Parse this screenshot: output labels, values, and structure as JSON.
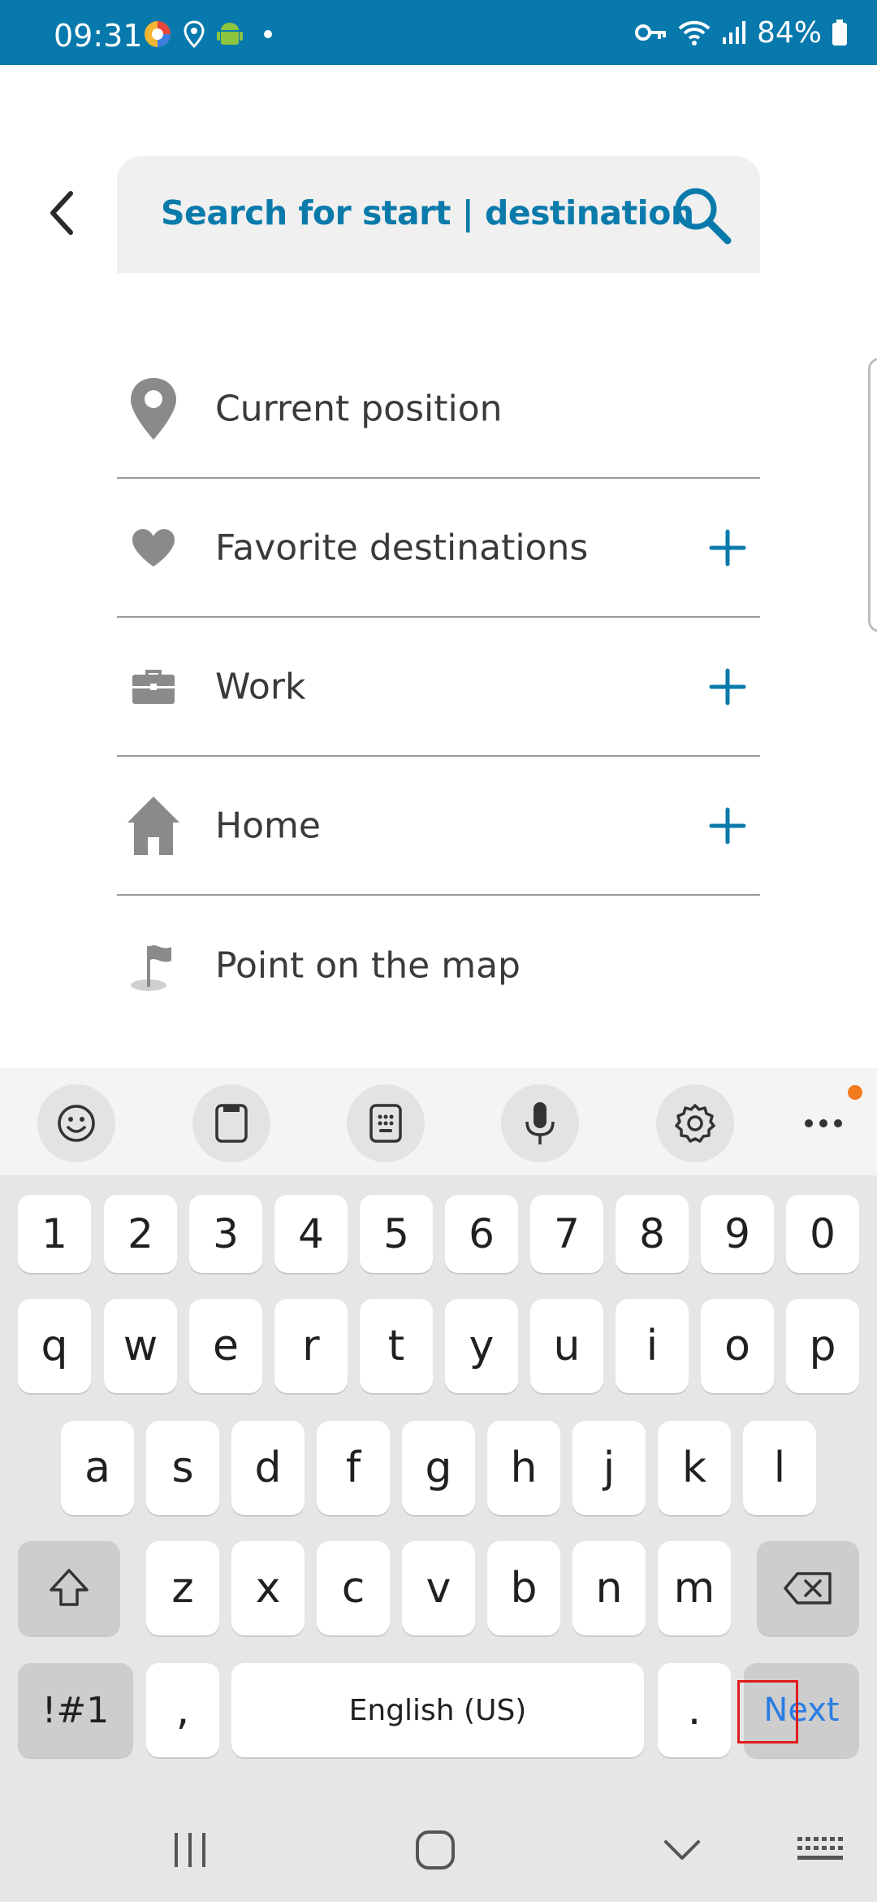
{
  "status_bar": {
    "time": "09:31",
    "battery": "84%",
    "left_icons": [
      "app-color-icon",
      "location-icon",
      "android-icon",
      "dot-icon"
    ],
    "right_icons": [
      "key-icon",
      "wifi-icon",
      "signal-icon",
      "battery-icon"
    ]
  },
  "header": {
    "search_placeholder": "Search for start | destination"
  },
  "list": {
    "items": [
      {
        "label": "Current position",
        "icon": "location-pin-icon",
        "has_add": false
      },
      {
        "label": "Favorite destinations",
        "icon": "heart-icon",
        "has_add": true
      },
      {
        "label": "Work",
        "icon": "briefcase-icon",
        "has_add": true
      },
      {
        "label": "Home",
        "icon": "house-icon",
        "has_add": true
      },
      {
        "label": "Point on the map",
        "icon": "flag-icon",
        "has_add": false
      }
    ]
  },
  "keyboard": {
    "toolbar": [
      "emoji-icon",
      "clipboard-icon",
      "keypad-icon",
      "microphone-icon",
      "settings-icon",
      "more-icon"
    ],
    "numbers": [
      "1",
      "2",
      "3",
      "4",
      "5",
      "6",
      "7",
      "8",
      "9",
      "0"
    ],
    "row1": [
      "q",
      "w",
      "e",
      "r",
      "t",
      "y",
      "u",
      "i",
      "o",
      "p"
    ],
    "row2": [
      "a",
      "s",
      "d",
      "f",
      "g",
      "h",
      "j",
      "k",
      "l"
    ],
    "row3": [
      "z",
      "x",
      "c",
      "v",
      "b",
      "n",
      "m"
    ],
    "symbols_label": "!#1",
    "comma": ",",
    "space_label": "English (US)",
    "period": ".",
    "next_label": "Next"
  },
  "colors": {
    "status_bar": "#0779ac",
    "accent": "#0a7aab",
    "next_key": "#2b7de3",
    "highlight": "#e11b1b"
  }
}
